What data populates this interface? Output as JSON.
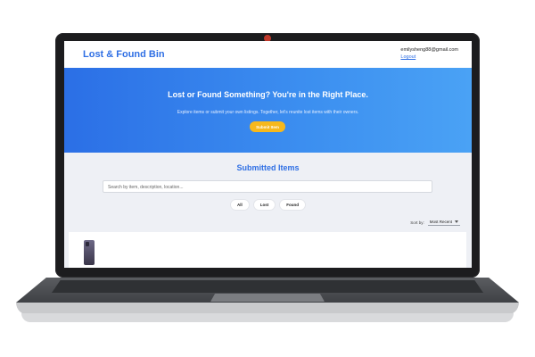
{
  "header": {
    "brand": "Lost & Found Bin",
    "email": "emilysheng88@gmail.com",
    "logout": "Logout"
  },
  "hero": {
    "title": "Lost or Found Something? You're in the Right Place.",
    "subtitle": "Explore items or submit your own listings. Together, let's reunite lost items with their owners.",
    "submit_button": "Submit Item"
  },
  "items": {
    "title": "Submitted Items",
    "search_placeholder": "Search by item, description, location...",
    "filters": [
      "All",
      "Lost",
      "Found"
    ],
    "sort_label": "Sort by:",
    "sort_value": "Most Recent"
  },
  "colors": {
    "accent": "#2f6fe4",
    "button": "#f6b81c",
    "camera": "#c0392b"
  }
}
